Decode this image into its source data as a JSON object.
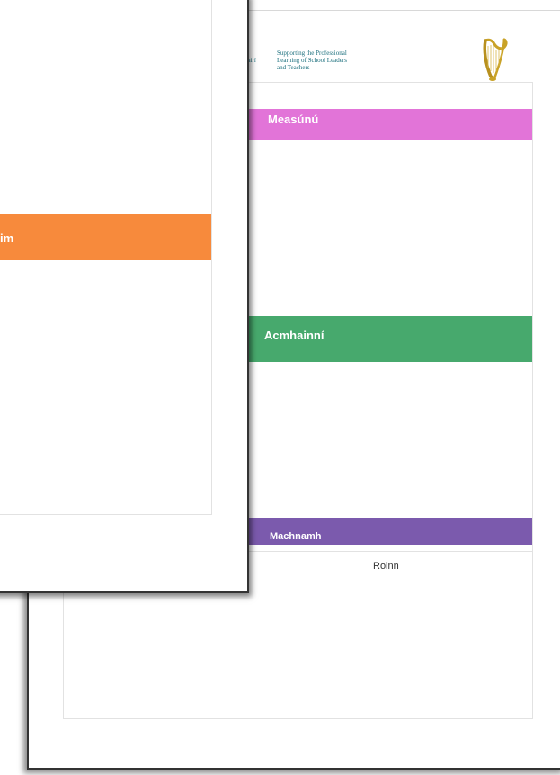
{
  "back_page": {
    "header_fragment": "nairí",
    "header_lines": [
      "Supporting the Professional",
      "Learning of School Leaders",
      "and Teachers"
    ],
    "logo_icon": "harp-icon",
    "sections": {
      "measunu": "Measúnú",
      "acmhainni": "Acmhainní",
      "machnamh": "Machnamh"
    },
    "roinn_label": "Roinn"
  },
  "front_page": {
    "orange_band_label_fragment": "im"
  },
  "colors": {
    "measunu": "#e274d8",
    "acmhainni": "#47a96d",
    "machnamh": "#7b5aad",
    "orange": "#f78a3c",
    "header_text": "#1b6f7d",
    "harp_gold": "#c9a227"
  }
}
